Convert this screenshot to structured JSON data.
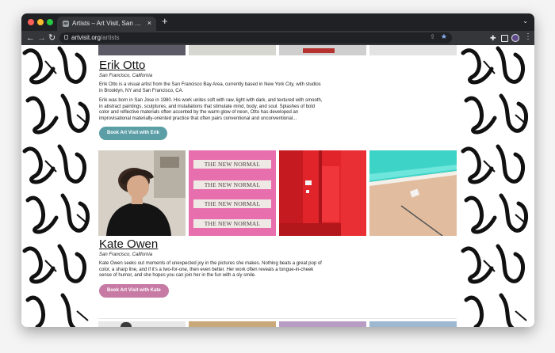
{
  "browser": {
    "tab_title": "Artists – Art Visit, San Francisco",
    "tab_close": "×",
    "new_tab": "+",
    "url_host": "artvisit.org",
    "url_path": "/artists"
  },
  "pattern_glyph": "Art",
  "artists": [
    {
      "name": "Erik Otto",
      "location": "San Francisco, California",
      "bio_1": "Erik Otto is a visual artist from the San Francisco Bay Area, currently based in New York City, with studios in Brooklyn, NY and San Francisco, CA.",
      "bio_2": "Erik was born in San Jose in 1980. His work unites soft with raw, light with dark, and textured with smooth, in abstract paintings, sculptures, and installations that stimulate mind, body, and soul. Splashes of bold color and reflective materials often accented by the warm glow of neon, Otto has developed an improvisational materially-oriented practice that often pairs conventional and unconventional...",
      "button": "Book Art Visit with Erik",
      "button_color": "#5b9ea6"
    },
    {
      "name": "Kate Owen",
      "location": "San Francisco, California",
      "bio_1": "Kate Owen seeks out moments of unexpected joy in the pictures she makes. Nothing beats a great pop of color, a sharp line, and if it's a two-for-one, then even better. Her work often reveals a tongue-in-cheek sense of humor, and she hopes you can join her in the fun with a sly smile.",
      "button": "Book Art Visit with Kate",
      "button_color": "#c77aa4"
    }
  ],
  "kate_photos": {
    "new_normal_text": "THE NEW NORMAL"
  }
}
